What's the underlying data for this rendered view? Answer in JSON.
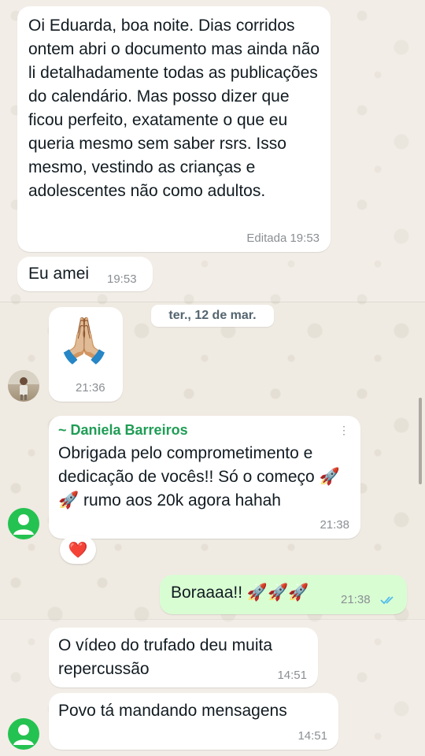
{
  "messages": [
    {
      "text": "Oi Eduarda, boa noite. Dias corridos ontem abri o documento mas ainda não li detalhadamente todas as publicações do calendário. Mas posso dizer que ficou perfeito, exatamente o que eu queria mesmo sem saber rsrs. Isso mesmo, vestindo as crianças e adolescentes não como adultos.",
      "time": "Editada 19:53"
    },
    {
      "text": "Eu amei",
      "time": "19:53"
    },
    {
      "text": "🙏🏼",
      "time": "21:36"
    },
    {
      "sender": "~ Daniela Barreiros",
      "text": "Obrigada pelo comprometimento e dedicação de vocês!! Só o começo 🚀🚀 rumo aos 20k agora hahah",
      "time": "21:38",
      "reaction": "❤️"
    },
    {
      "text": "Boraaaa!! 🚀🚀🚀",
      "time": "21:38",
      "status": "read"
    },
    {
      "text": "O vídeo do trufado deu muita repercussão",
      "time": "14:51"
    },
    {
      "text": "Povo tá mandando mensagens",
      "time": "14:51"
    }
  ],
  "date_separator": "ter., 12 de mar.",
  "colors": {
    "incoming": "#ffffff",
    "outgoing": "#d9fdd3",
    "sender_name": "#1f9d55",
    "read_check": "#53bdeb",
    "avatar_default": "#24c251"
  }
}
